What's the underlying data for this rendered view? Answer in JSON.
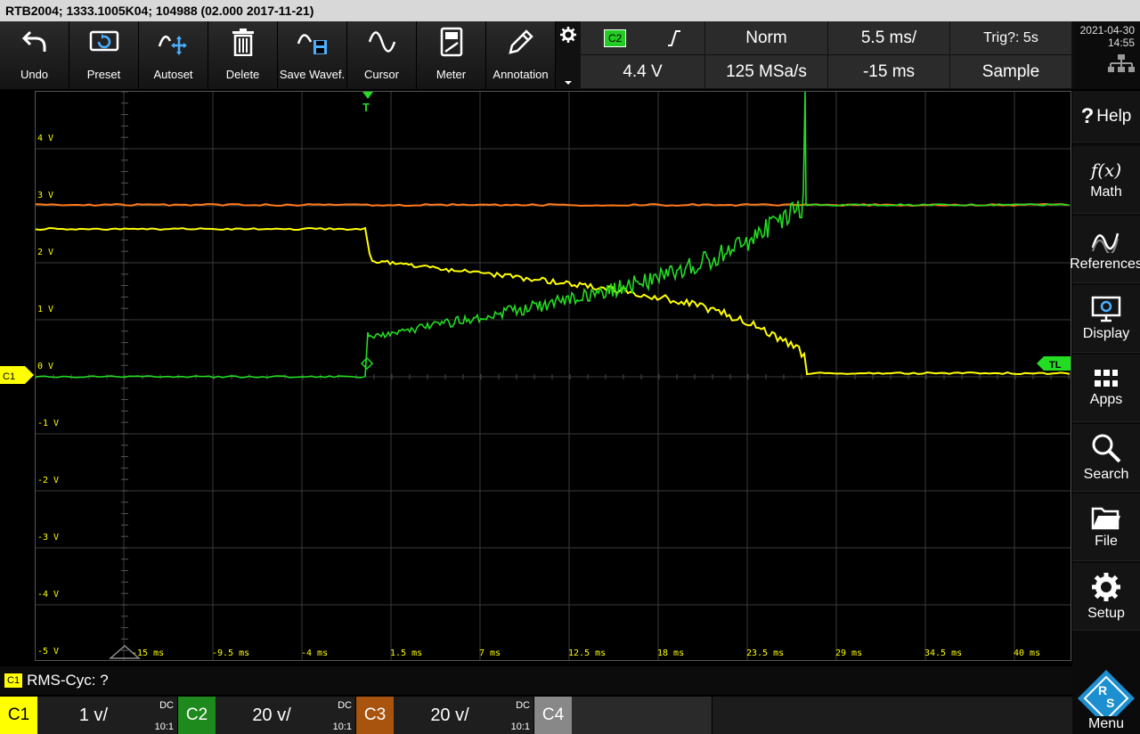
{
  "title": "RTB2004; 1333.1005K04; 104988 (02.000 2017-11-21)",
  "toolbar": [
    {
      "label": "Undo",
      "icon": "undo-icon"
    },
    {
      "label": "Preset",
      "icon": "preset-icon"
    },
    {
      "label": "Autoset",
      "icon": "autoset-icon"
    },
    {
      "label": "Delete",
      "icon": "trash-icon"
    },
    {
      "label": "Save Wavef.",
      "icon": "save-waveform-icon"
    },
    {
      "label": "Cursor",
      "icon": "cursor-icon"
    },
    {
      "label": "Meter",
      "icon": "meter-icon"
    },
    {
      "label": "Annotation",
      "icon": "pencil-icon"
    }
  ],
  "acquisition": {
    "trig_source": "C2",
    "trig_level": "4.4 V",
    "trig_mode": "Norm",
    "timebase": "5.5 ms/",
    "sample_rate": "125 MSa/s",
    "trig_status": "Trig?: 5s",
    "position": "-15 ms",
    "acq_mode": "Sample"
  },
  "datetime": {
    "date": "2021-04-30",
    "time": "14:55"
  },
  "graph": {
    "y_labels": [
      "4 V",
      "3 V",
      "2 V",
      "1 V",
      "0 V",
      "-1 V",
      "-2 V",
      "-3 V",
      "-4 V",
      "-5 V"
    ],
    "x_labels": [
      "-15 ms",
      "-9.5 ms",
      "-4 ms",
      "1.5 ms",
      "7 ms",
      "12.5 ms",
      "18 ms",
      "23.5 ms",
      "29 ms",
      "34.5 ms",
      "40 ms"
    ],
    "trigger_marker": "T",
    "trigger_level_marker": "TL",
    "channel_marker": "C1",
    "colors": {
      "c1": "#ffff00",
      "c2": "#22dd22",
      "c3": "#ff7a1a",
      "grid": "#3a3a3a"
    }
  },
  "right_menu": [
    {
      "label": "Help",
      "icon": "help-icon",
      "glyph": "?"
    },
    {
      "label": "Math",
      "icon": "math-icon",
      "glyph": "f(x)"
    },
    {
      "label": "References",
      "icon": "references-icon"
    },
    {
      "label": "Display",
      "icon": "display-icon"
    },
    {
      "label": "Apps",
      "icon": "apps-icon"
    },
    {
      "label": "Search",
      "icon": "search-icon"
    },
    {
      "label": "File",
      "icon": "folder-icon"
    },
    {
      "label": "Setup",
      "icon": "gear-icon"
    }
  ],
  "measurement": {
    "channel": "C1",
    "text": "RMS-Cyc: ?"
  },
  "channels": [
    {
      "name": "C1",
      "scale": "1 v/",
      "coupling": "DC",
      "probe": "10:1",
      "color": "#ffff00"
    },
    {
      "name": "C2",
      "scale": "20 v/",
      "coupling": "DC",
      "probe": "10:1",
      "color": "#1e9e1e"
    },
    {
      "name": "C3",
      "scale": "20 v/",
      "coupling": "DC",
      "probe": "10:1",
      "color": "#b05a10"
    },
    {
      "name": "C4",
      "scale": "",
      "coupling": "",
      "probe": "",
      "color": "#777777"
    }
  ],
  "menu_label": "Menu"
}
